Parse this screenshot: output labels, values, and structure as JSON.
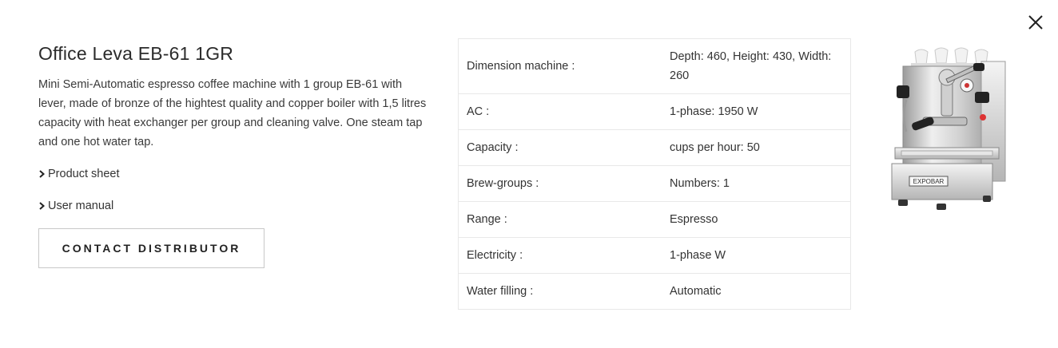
{
  "close": {
    "icon": "close-icon"
  },
  "product": {
    "title": "Office Leva EB-61 1GR",
    "description": "Mini Semi-Automatic espresso coffee machine with 1 group EB-61 with lever, made of bronze of the hightest quality and copper boiler with 1,5 litres capacity with heat exchanger per group and cleaning valve. One steam tap and one hot water tap.",
    "links": [
      {
        "label": "Product sheet",
        "icon": "chevron-right-icon"
      },
      {
        "label": "User manual",
        "icon": "chevron-right-icon"
      }
    ],
    "contact_label": "CONTACT DISTRIBUTOR",
    "image_brand": "EXPOBAR"
  },
  "specs": [
    {
      "label": "Dimension machine :",
      "value": "Depth: 460, Height: 430, Width: 260"
    },
    {
      "label": "AC :",
      "value": "1-phase: 1950 W"
    },
    {
      "label": "Capacity :",
      "value": "cups per hour: 50"
    },
    {
      "label": "Brew-groups :",
      "value": "Numbers: 1"
    },
    {
      "label": "Range :",
      "value": "Espresso"
    },
    {
      "label": "Electricity :",
      "value": "1-phase W"
    },
    {
      "label": "Water filling :",
      "value": "Automatic"
    }
  ],
  "colors": {
    "text": "#333333",
    "border": "#e8e8e8",
    "button_border": "#c8c8c8"
  }
}
